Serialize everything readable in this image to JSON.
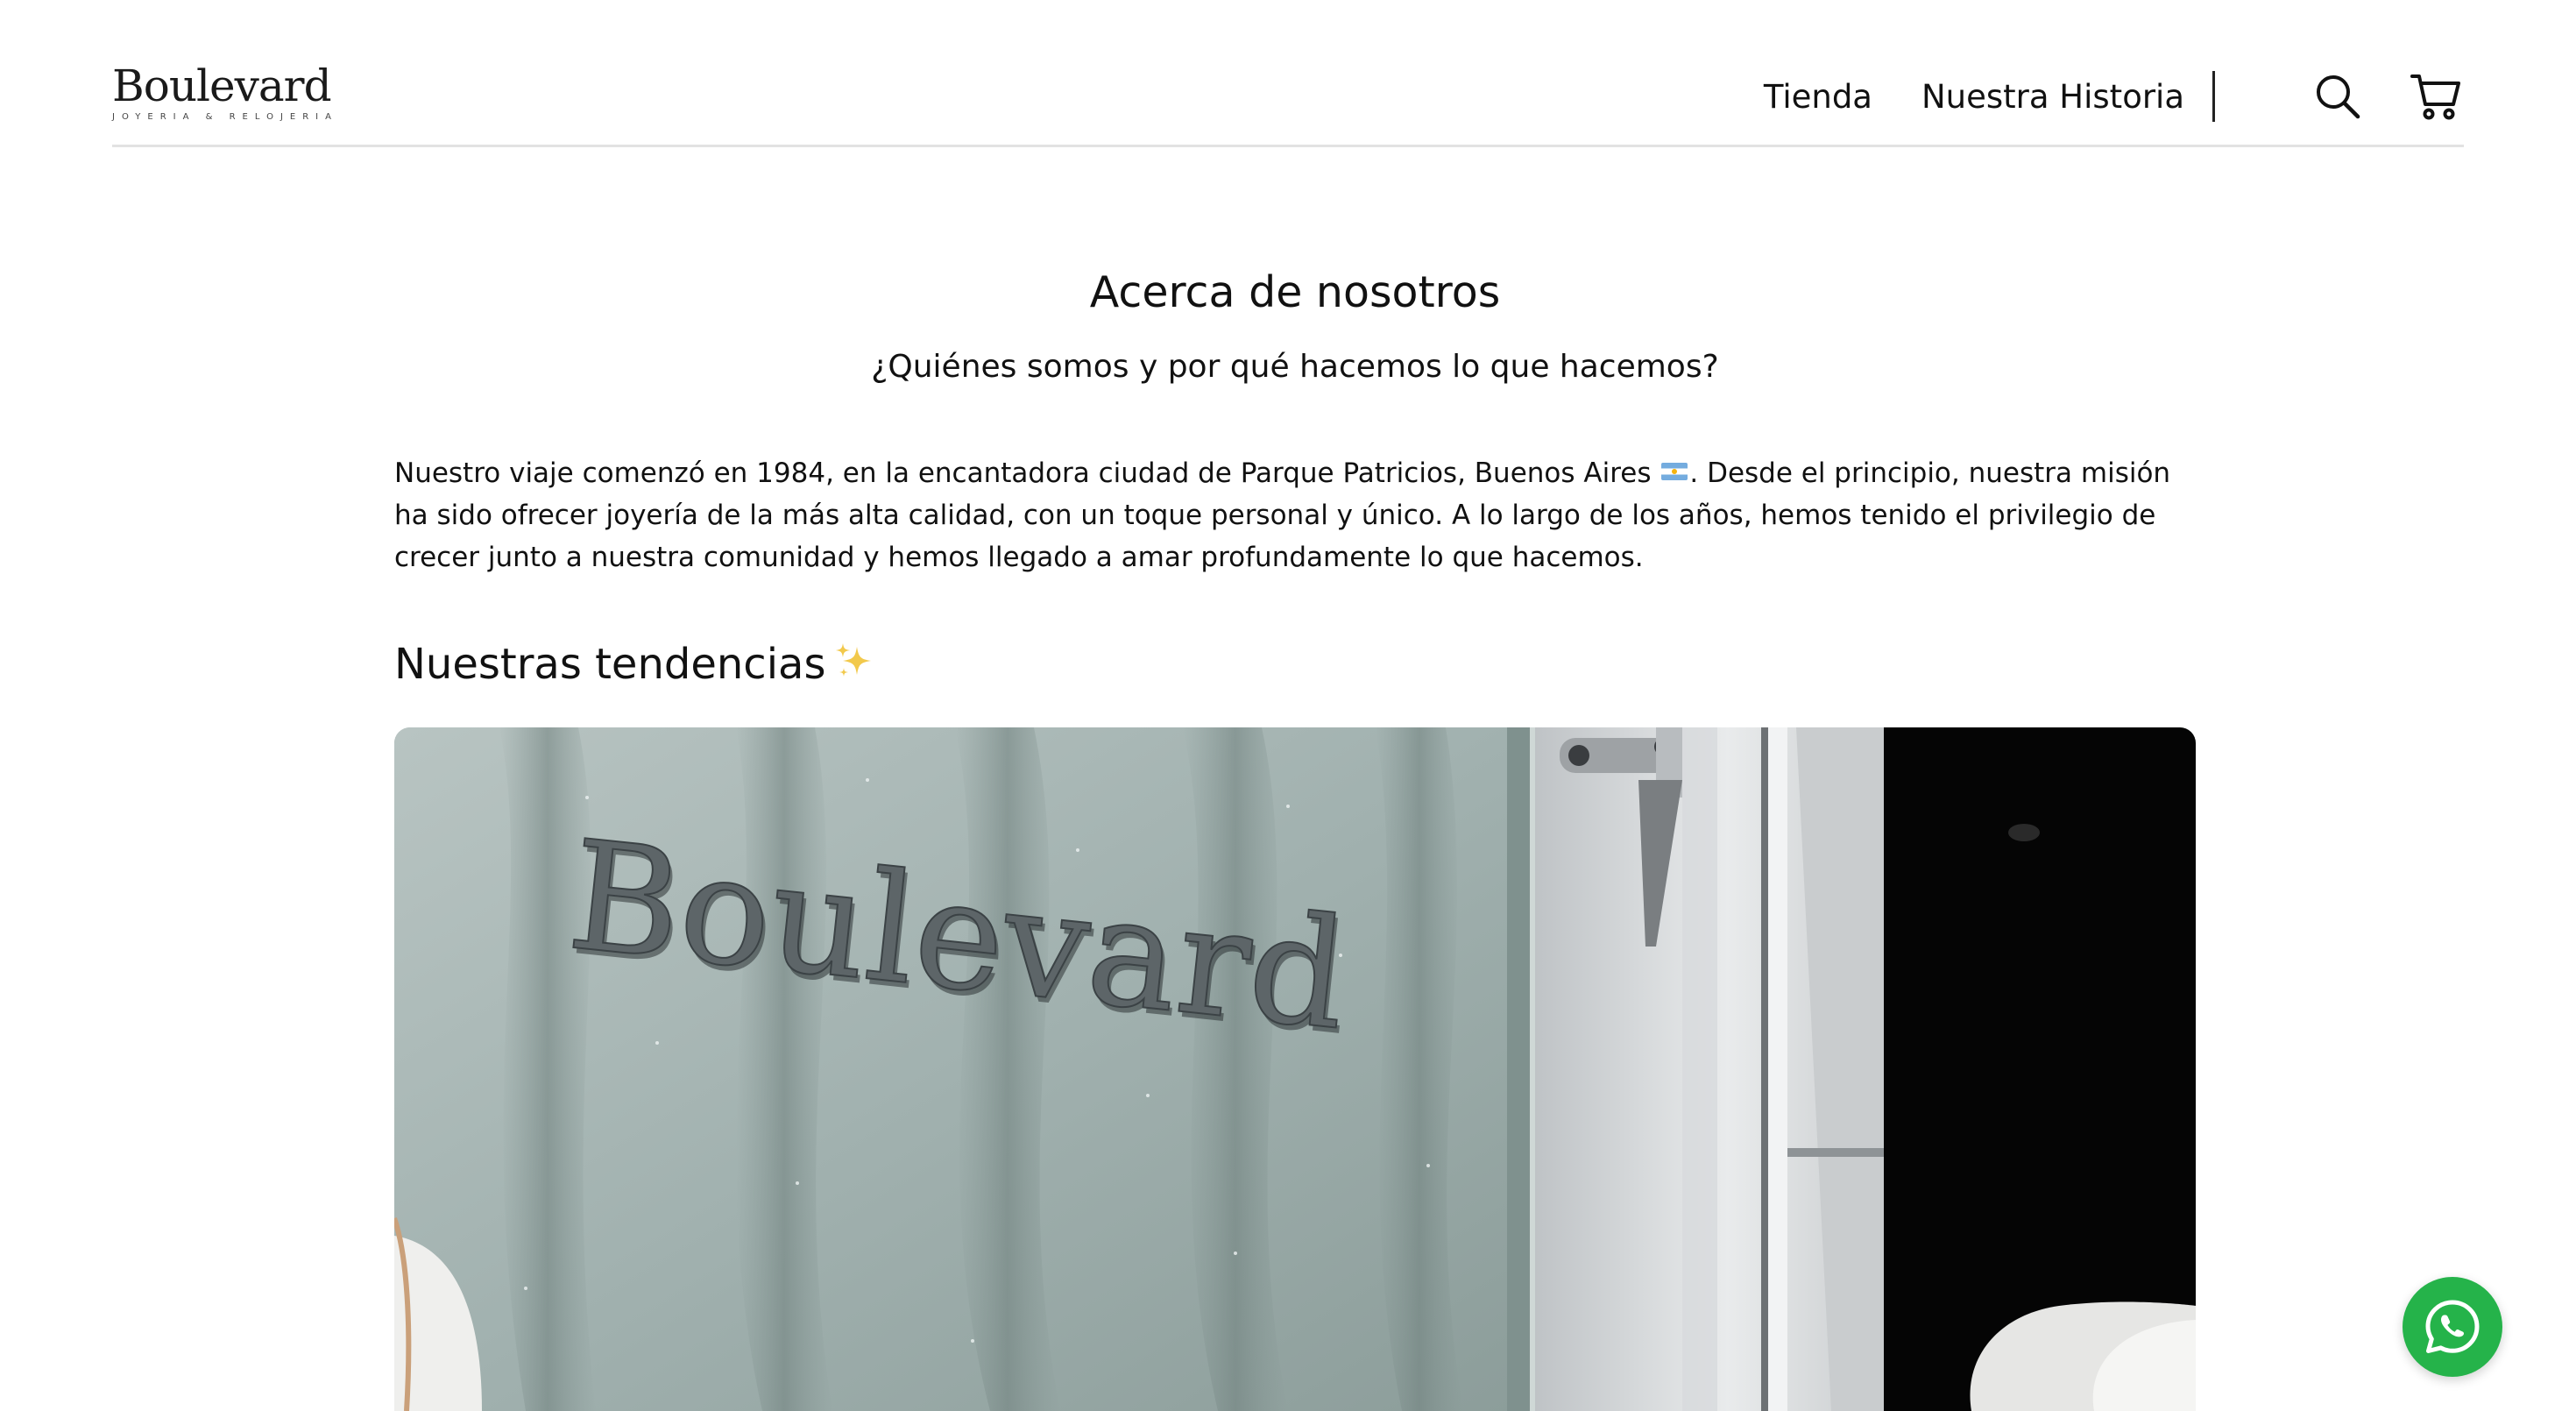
{
  "brand": {
    "name": "Boulevard",
    "tagline": "JOYERIA & RELOJERIA"
  },
  "nav": {
    "items": [
      {
        "label": "Tienda"
      },
      {
        "label": "Nuestra Historia"
      }
    ],
    "icons": [
      "search-icon",
      "cart-icon"
    ]
  },
  "main": {
    "title": "Acerca de nosotros",
    "subtitle": "¿Quiénes somos y por qué hacemos lo que hacemos?",
    "intro_part1": "Nuestro viaje comenzó en 1984, en la encantadora ciudad de Parque Patricios, Buenos Aires",
    "intro_part2": ". Desde el principio, nuestra misión ha sido ofrecer joyería de la más alta calidad, con un toque personal y único. A lo largo de los años, hemos tenido el privilegio de crecer junto a nuestra comunidad y hemos llegado a amar profundamente lo que hacemos.",
    "section_title": "Nuestras tendencias",
    "image_sign_text": "Boulevard"
  },
  "colors": {
    "text": "#111111",
    "divider": "#e2e2e2",
    "whatsapp": "#25b34a",
    "sparkle": "#f2c94c"
  },
  "floating": {
    "whatsapp_icon": "whatsapp-icon"
  }
}
